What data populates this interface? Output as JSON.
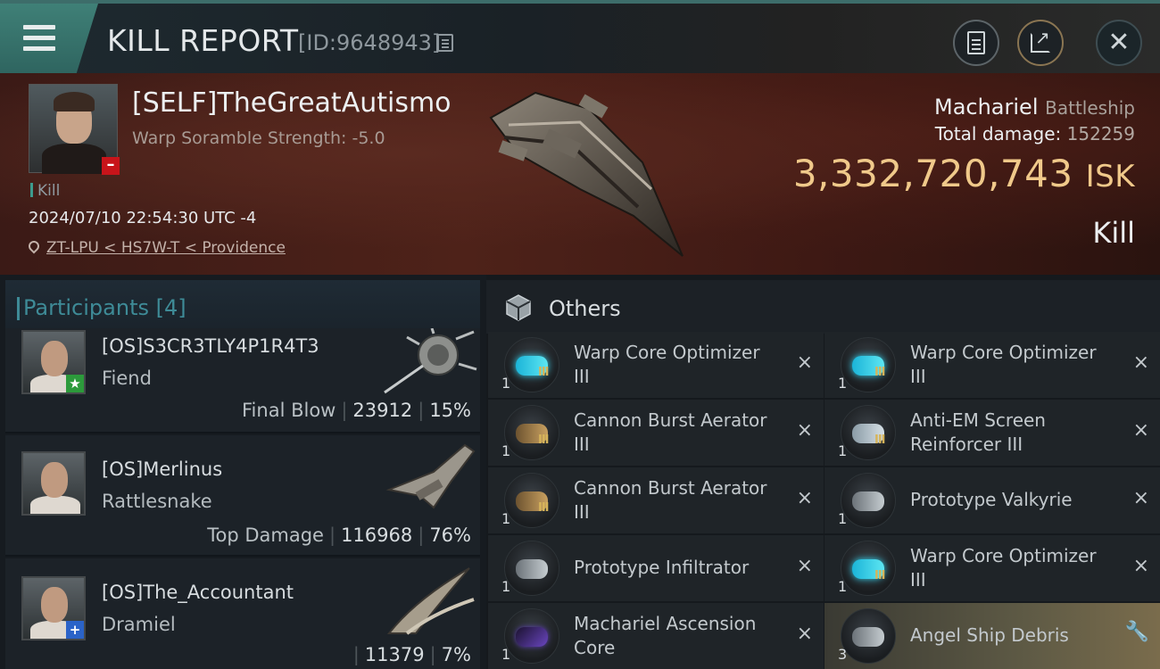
{
  "header": {
    "title": "KILL REPORT",
    "report_id": "[ID:9648943]"
  },
  "victim": {
    "name": "[SELF]TheGreatAutismo",
    "scramble": "Warp Soramble Strength: -5.0",
    "tag": "Kill",
    "datetime": "2024/07/10 22:54:30 UTC -4",
    "location": "ZT-LPU < HS7W-T < Providence",
    "ship": "Machariel",
    "ship_class": "Battleship",
    "total_damage_label": "Total damage:",
    "total_damage": "152259",
    "isk_value": "3,332,720,743",
    "isk_unit": "ISK",
    "result": "Kill"
  },
  "participants": {
    "label": "Participants [4]",
    "rows": [
      {
        "name": "[OS]S3CR3TLY4P1R4T3",
        "ship": "Fiend",
        "role": "Final Blow",
        "damage": "23912",
        "percent": "15%",
        "badge": "star"
      },
      {
        "name": "[OS]Merlinus",
        "ship": "Rattlesnake",
        "role": "Top Damage",
        "damage": "116968",
        "percent": "76%",
        "badge": ""
      },
      {
        "name": "[OS]The_Accountant",
        "ship": "Dramiel",
        "role": "",
        "damage": "11379",
        "percent": "7%",
        "badge": "plus"
      }
    ]
  },
  "others": {
    "label": "Others",
    "items": [
      {
        "qty": "1",
        "name": "Warp Core Optimizer III",
        "tier": "III",
        "icon": "warp-core-optimizer-icon",
        "action": "×"
      },
      {
        "qty": "1",
        "name": "Warp Core Optimizer III",
        "tier": "III",
        "icon": "warp-core-optimizer-icon",
        "action": "×"
      },
      {
        "qty": "1",
        "name": "Cannon Burst Aerator III",
        "tier": "III",
        "icon": "cannon-burst-aerator-icon",
        "action": "×"
      },
      {
        "qty": "1",
        "name": "Anti-EM Screen Reinforcer III",
        "tier": "III",
        "icon": "anti-em-screen-icon",
        "action": "×"
      },
      {
        "qty": "1",
        "name": "Cannon Burst Aerator III",
        "tier": "III",
        "icon": "cannon-burst-aerator-icon",
        "action": "×"
      },
      {
        "qty": "1",
        "name": "Prototype  Valkyrie",
        "tier": "",
        "icon": "valkyrie-drone-icon",
        "action": "×"
      },
      {
        "qty": "1",
        "name": "Prototype  Infiltrator",
        "tier": "",
        "icon": "infiltrator-drone-icon",
        "action": "×"
      },
      {
        "qty": "1",
        "name": "Warp Core Optimizer III",
        "tier": "III",
        "icon": "warp-core-optimizer-icon",
        "action": "×"
      },
      {
        "qty": "1",
        "name": "Machariel Ascension Core",
        "tier": "",
        "icon": "ascension-core-icon",
        "action": "×"
      },
      {
        "qty": "3",
        "name": "Angel Ship Debris",
        "tier": "",
        "icon": "ship-debris-icon",
        "action": "wrench"
      }
    ]
  },
  "colors": {
    "accent_teal": "#3e8b97",
    "isk_gold": "#f0c98a",
    "badge_red": "#c8141a",
    "badge_green": "#2c9a3b",
    "badge_blue": "#2b63c8"
  }
}
